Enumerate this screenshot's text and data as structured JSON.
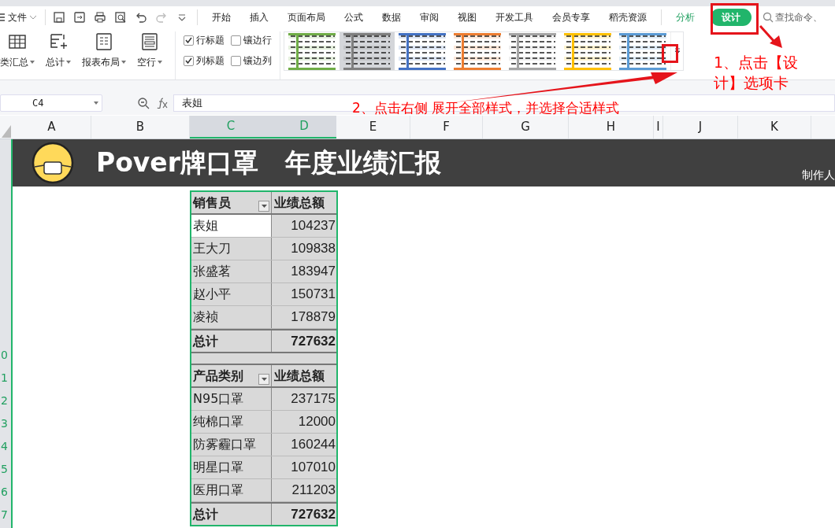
{
  "menu_bar": {
    "file_menu": "文件",
    "tabs": [
      {
        "label": "开始",
        "selected": false,
        "contextual": false
      },
      {
        "label": "插入",
        "selected": false,
        "contextual": false
      },
      {
        "label": "页面布局",
        "selected": false,
        "contextual": false
      },
      {
        "label": "公式",
        "selected": false,
        "contextual": false
      },
      {
        "label": "数据",
        "selected": false,
        "contextual": false
      },
      {
        "label": "审阅",
        "selected": false,
        "contextual": false
      },
      {
        "label": "视图",
        "selected": false,
        "contextual": false
      },
      {
        "label": "开发工具",
        "selected": false,
        "contextual": false
      },
      {
        "label": "会员专享",
        "selected": false,
        "contextual": false
      },
      {
        "label": "稻壳资源",
        "selected": false,
        "contextual": false
      },
      {
        "label": "分析",
        "selected": false,
        "contextual": true
      },
      {
        "label": "设计",
        "selected": true,
        "contextual": true
      }
    ],
    "search": {
      "placeholder": "查找命令、"
    }
  },
  "ribbon": {
    "buttons": [
      {
        "label": "类汇总",
        "kind": "grid"
      },
      {
        "label": "总计",
        "kind": "total"
      },
      {
        "label": "报表布局",
        "kind": "layout"
      },
      {
        "label": "空行",
        "kind": "blank"
      }
    ],
    "checkboxes": [
      {
        "label": "行标题",
        "checked": true
      },
      {
        "label": "镶边行",
        "checked": false
      },
      {
        "label": "列标题",
        "checked": true
      },
      {
        "label": "镶边列",
        "checked": false
      }
    ],
    "styles": [
      {
        "color": "#70ad47",
        "selected": false
      },
      {
        "color": "#7f7f7f",
        "selected": true
      },
      {
        "color": "#4472c4",
        "selected": false
      },
      {
        "color": "#ed7d31",
        "selected": false
      },
      {
        "color": "#a5a5a5",
        "selected": false
      },
      {
        "color": "#ffc000",
        "selected": false
      },
      {
        "color": "#5b9bd5",
        "selected": false
      }
    ]
  },
  "formula_bar": {
    "cell_ref": "C4",
    "value": "表姐"
  },
  "columns": [
    {
      "label": "A",
      "selected": false
    },
    {
      "label": "B",
      "selected": false
    },
    {
      "label": "C",
      "selected": true
    },
    {
      "label": "D",
      "selected": true
    },
    {
      "label": "E",
      "selected": false
    },
    {
      "label": "F",
      "selected": false
    },
    {
      "label": "G",
      "selected": false
    },
    {
      "label": "H",
      "selected": false
    },
    {
      "label": "I",
      "selected": false
    },
    {
      "label": "J",
      "selected": false
    },
    {
      "label": "K",
      "selected": false
    }
  ],
  "row_numbers": [
    "0",
    "1",
    "2",
    "3",
    "4",
    "5",
    "6",
    "7"
  ],
  "banner": {
    "title": "Pover牌口罩   年度业绩汇报",
    "author": "制作人"
  },
  "pivot_tables": [
    {
      "columns": [
        "销售员",
        "业绩总额"
      ],
      "rows": [
        {
          "label": "表姐",
          "value": "104237",
          "selected": true
        },
        {
          "label": "王大刀",
          "value": "109838",
          "selected": false
        },
        {
          "label": "张盛茗",
          "value": "183947",
          "selected": false
        },
        {
          "label": "赵小平",
          "value": "150731",
          "selected": false
        },
        {
          "label": "凌祯",
          "value": "178879",
          "selected": false
        }
      ],
      "total": {
        "label": "总计",
        "value": "727632"
      }
    },
    {
      "columns": [
        "产品类别",
        "业绩总额"
      ],
      "rows": [
        {
          "label": "N95口罩",
          "value": "237175",
          "selected": false
        },
        {
          "label": "纯棉口罩",
          "value": "12000",
          "selected": false
        },
        {
          "label": "防雾霾口罩",
          "value": "160244",
          "selected": false
        },
        {
          "label": "明星口罩",
          "value": "107010",
          "selected": false
        },
        {
          "label": "医用口罩",
          "value": "211203",
          "selected": false
        }
      ],
      "total": {
        "label": "总计",
        "value": "727632"
      }
    }
  ],
  "annotations": [
    "1、点击【设计】选项卡",
    "2、点击右侧 展开全部样式，并选择合适样式"
  ]
}
